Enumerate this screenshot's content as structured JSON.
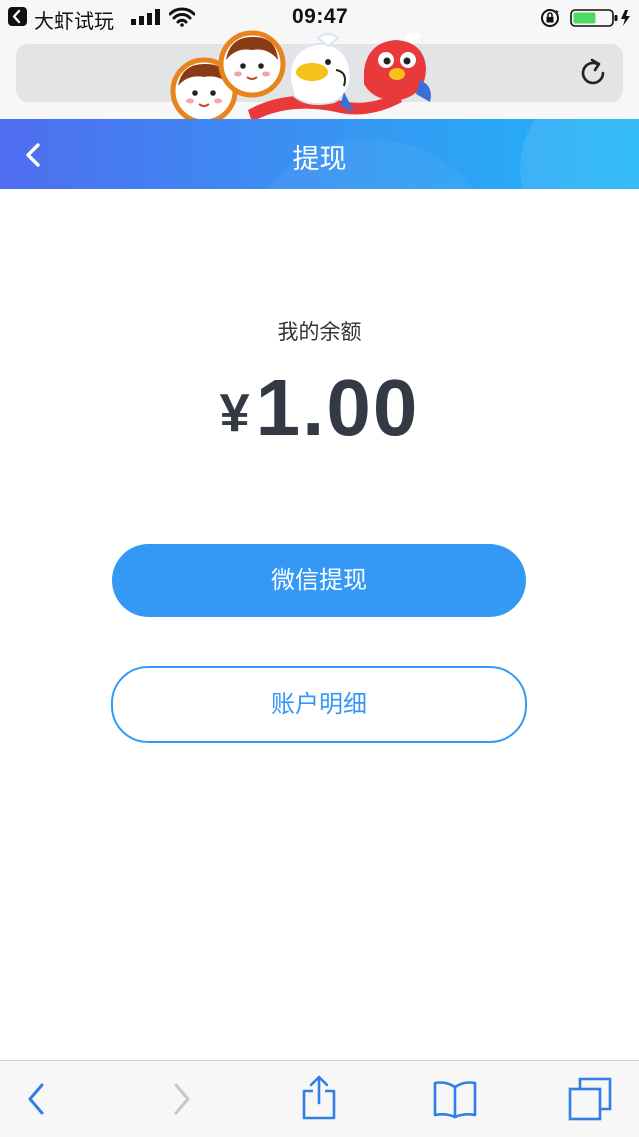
{
  "status_bar": {
    "app_name": "大虾试玩",
    "time": "09:47"
  },
  "header": {
    "title": "提现"
  },
  "balance": {
    "label": "我的余额",
    "currency": "¥",
    "amount": "1.00"
  },
  "buttons": {
    "withdraw": "微信提现",
    "details": "账户明细"
  },
  "icons": {
    "status": [
      "back-icon",
      "signal-icon",
      "wifi-icon",
      "rotation-lock-icon",
      "battery-icon"
    ],
    "browser": [
      "reload-icon",
      "back-icon",
      "forward-icon",
      "share-icon",
      "bookmarks-icon",
      "tabs-icon"
    ]
  },
  "colors": {
    "accent": "#3399f5",
    "header_gradient_start": "#4f6df0",
    "header_gradient_end": "#1fb6f7",
    "amount_text": "#333a44"
  }
}
